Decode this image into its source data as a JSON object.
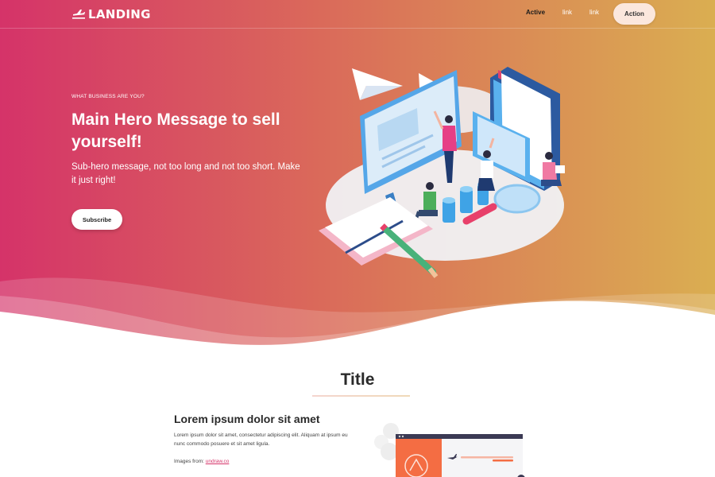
{
  "nav": {
    "logo_text": "LANDING",
    "logo_icon": "airplane-icon",
    "links": [
      "Active",
      "link",
      "link"
    ],
    "action_label": "Action"
  },
  "hero": {
    "eyebrow": "WHAT BUSINESS ARE YOU?",
    "title": "Main Hero Message to sell yourself!",
    "subtitle": "Sub-hero message, not too long and not too short. Make it just right!",
    "button_label": "Subscribe"
  },
  "section": {
    "title": "Title",
    "heading": "Lorem ipsum dolor sit amet",
    "text": "Lorem ipsum dolor sit amet, consectetur adipiscing elit. Aliquam at ipsum eu nunc commodo posuere et sit amet ligula.",
    "credit_prefix": "Images from:",
    "credit_link": "undraw.co"
  },
  "colors": {
    "gradient_start": "#d53369",
    "gradient_end": "#daae51",
    "action_bg": "#fbe7dd",
    "link_accent": "#d53369"
  }
}
